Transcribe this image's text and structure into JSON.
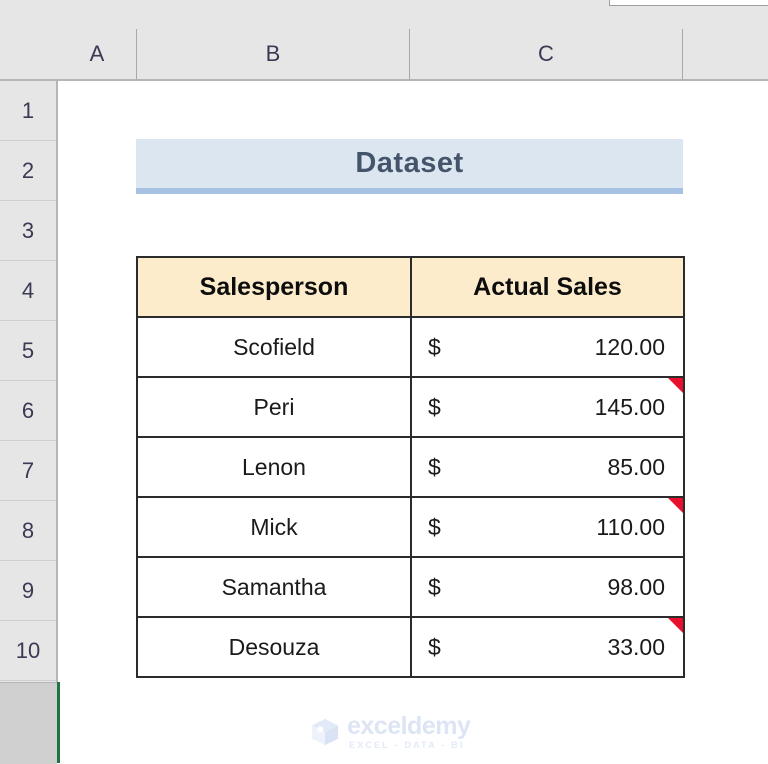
{
  "app": {
    "type": "spreadsheet",
    "column_headers": [
      "A",
      "B",
      "C"
    ],
    "row_headers": [
      "1",
      "2",
      "3",
      "4",
      "5",
      "6",
      "7",
      "8",
      "9",
      "10"
    ]
  },
  "title_cell": {
    "text": "Dataset",
    "fill_color": "#DCE6F1",
    "accent_color": "#A7C1E3",
    "text_color": "#44546A"
  },
  "table": {
    "headers": [
      "Salesperson",
      "Actual Sales"
    ],
    "header_fill": "#FDECCC",
    "rows": [
      {
        "name": "Scofield",
        "currency": "$",
        "amount": "120.00",
        "has_comment": false
      },
      {
        "name": "Peri",
        "currency": "$",
        "amount": "145.00",
        "has_comment": true
      },
      {
        "name": "Lenon",
        "currency": "$",
        "amount": "85.00",
        "has_comment": false
      },
      {
        "name": "Mick",
        "currency": "$",
        "amount": "110.00",
        "has_comment": true
      },
      {
        "name": "Samantha",
        "currency": "$",
        "amount": "98.00",
        "has_comment": false
      },
      {
        "name": "Desouza",
        "currency": "$",
        "amount": "33.00",
        "has_comment": true
      }
    ]
  },
  "watermark": {
    "name": "exceldemy",
    "tagline": "EXCEL - DATA - BI",
    "color": "#DDE5F5"
  }
}
